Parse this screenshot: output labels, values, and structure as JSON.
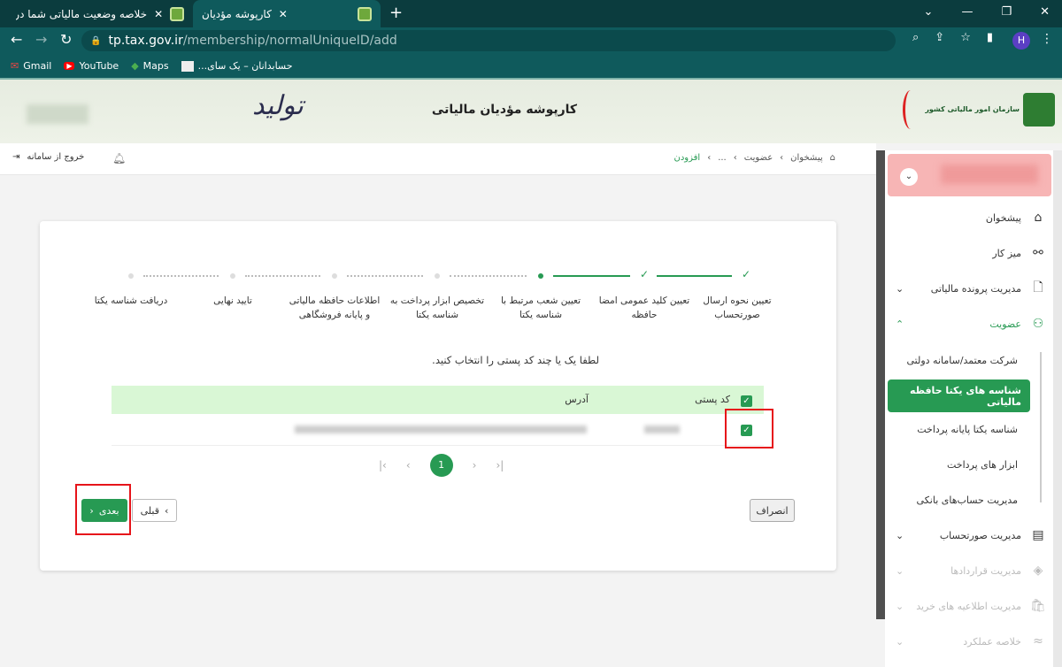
{
  "browser": {
    "tabs": [
      {
        "title": "خلاصه وضعیت مالیاتی شما در نظا",
        "active": false
      },
      {
        "title": "کارپوشه مؤدیان",
        "active": true
      }
    ],
    "url_host": "tp.tax.gov.ir",
    "url_path": "/membership/normalUniqueID/add",
    "bookmarks": [
      "Gmail",
      "YouTube",
      "Maps",
      "حسابدانان – یک سای..."
    ],
    "profile_initial": "H"
  },
  "header": {
    "title": "کارپوشه مؤدیان مالیاتی",
    "logo_text": "سازمان امور مالیاتی کشور",
    "slogan": "تولید"
  },
  "topbar": {
    "logout": "خروج از سامانه",
    "breadcrumb": [
      "پیشخوان",
      "عضویت",
      "...",
      "افزودن"
    ]
  },
  "sidebar": {
    "items": [
      {
        "label": "پیشخوان",
        "icon": "home-icon"
      },
      {
        "label": "میز کار",
        "icon": "workflow-icon"
      },
      {
        "label": "مدیریت پرونده مالیاتی",
        "icon": "file-icon",
        "chevron": "down"
      },
      {
        "label": "عضویت",
        "icon": "user-icon",
        "chevron": "up",
        "active": true
      },
      {
        "label": "مدیریت صورتحساب",
        "icon": "invoice-icon",
        "chevron": "down"
      },
      {
        "label": "مدیریت قراردادها",
        "icon": "handshake-icon",
        "chevron": "down",
        "disabled": true
      },
      {
        "label": "مدیریت اطلاعیه های خرید",
        "icon": "bag-icon",
        "chevron": "down",
        "disabled": true
      },
      {
        "label": "خلاصه عملکرد",
        "icon": "chart-icon",
        "chevron": "down",
        "disabled": true
      }
    ],
    "subitems": [
      "شرکت معتمد/سامانه دولتی",
      "شناسه های یکتا حافظه مالیاتی",
      "شناسه یکتا پایانه پرداخت",
      "ابزار های پرداخت",
      "مدیریت حساب‌های بانکی"
    ],
    "active_subitem": 1
  },
  "stepper": {
    "steps": [
      "تعیین نحوه ارسال صورتحساب",
      "تعیین کلید عمومی امضا حافظه",
      "تعیین شعب مرتبط با شناسه یکتا",
      "تخصیص ابزار پرداخت به شناسه یکتا",
      "اطلاعات حافظه مالیاتی و پایانه فروشگاهی",
      "تایید نهایی",
      "دریافت شناسه یکتا"
    ],
    "completed": 2,
    "current": 3
  },
  "form": {
    "instruction": "لطفا یک یا چند کد پستی را انتخاب کنید.",
    "columns": [
      "کد پستی",
      "آدرس"
    ],
    "rows": [
      {
        "checked": true
      }
    ],
    "page": "1",
    "buttons": {
      "next": "بعدی",
      "prev": "قبلی",
      "cancel": "انصراف"
    }
  },
  "colors": {
    "accent": "#279a53",
    "chrome": "#0f5a5c",
    "highlight": "#e6141a",
    "table_header": "#d9f7d5"
  }
}
